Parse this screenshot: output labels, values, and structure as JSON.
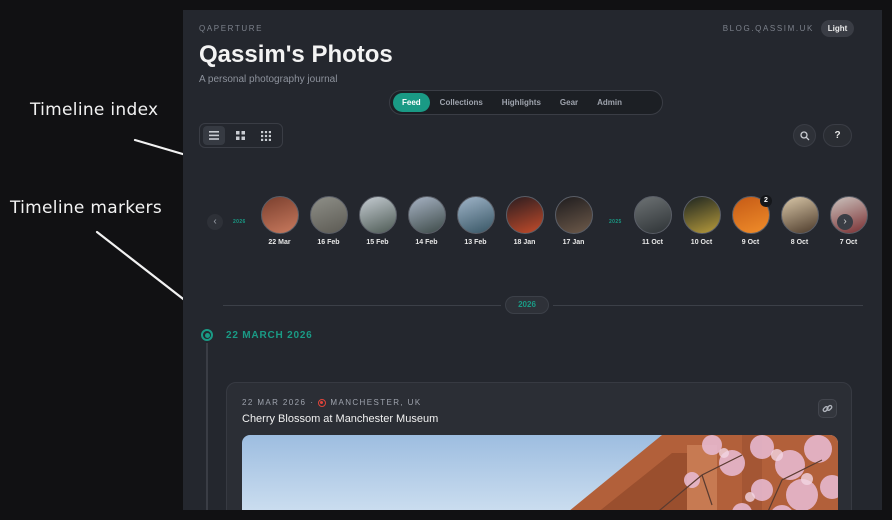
{
  "annotations": {
    "timeline_index": "Timeline index",
    "timeline_markers": "Timeline markers"
  },
  "header": {
    "brand": "QAPERTURE",
    "blog_link": "BLOG.QASSIM.UK",
    "theme_toggle": "Light",
    "title": "Qassim's Photos",
    "subtitle": "A personal photography journal"
  },
  "nav": {
    "tabs": [
      {
        "label": "Feed",
        "active": true
      },
      {
        "label": "Collections",
        "active": false
      },
      {
        "label": "Highlights",
        "active": false
      },
      {
        "label": "Gear",
        "active": false
      },
      {
        "label": "Admin",
        "active": false
      }
    ]
  },
  "toolbar": {
    "view_modes": [
      "list-icon",
      "grid-icon",
      "dense-grid-icon"
    ],
    "active_view": "list",
    "help_label": "?"
  },
  "timeline_index": {
    "year_tags": [
      "2026",
      "2025"
    ],
    "thumbs": [
      {
        "label": "22 Mar",
        "colors": [
          "#7a3f2e",
          "#c97a5e"
        ]
      },
      {
        "label": "16 Feb",
        "colors": [
          "#8e8f88",
          "#5c5a53"
        ]
      },
      {
        "label": "15 Feb",
        "colors": [
          "#c5ccd2",
          "#4d5a54"
        ]
      },
      {
        "label": "14 Feb",
        "colors": [
          "#a7b3c4",
          "#3d4a48"
        ]
      },
      {
        "label": "13 Feb",
        "colors": [
          "#9fb4c8",
          "#375564"
        ]
      },
      {
        "label": "18 Jan",
        "colors": [
          "#2a1c20",
          "#c44c2b"
        ]
      },
      {
        "label": "17 Jan",
        "colors": [
          "#1e1c1e",
          "#6e5a4a"
        ]
      },
      {
        "label": "11 Oct",
        "colors": [
          "#6d7274",
          "#2e3336"
        ]
      },
      {
        "label": "10 Oct",
        "colors": [
          "#1c2420",
          "#b89c3c"
        ]
      },
      {
        "label": "9 Oct",
        "colors": [
          "#c55a16",
          "#f08d2a"
        ],
        "count": "2"
      },
      {
        "label": "8 Oct",
        "colors": [
          "#d9c7a8",
          "#4c3a2a"
        ]
      },
      {
        "label": "7 Oct",
        "colors": [
          "#cbc3be",
          "#7a2f32"
        ]
      }
    ]
  },
  "year_divider": "2026",
  "timeline_marker": {
    "date_heading": "22 MARCH 2026"
  },
  "post": {
    "date": "22 MAR 2026",
    "separator": "·",
    "location": "MANCHESTER, UK",
    "title": "Cherry Blossom at Manchester Museum",
    "colors": {
      "sky": "#b9d2ea",
      "building": "#b2603a",
      "blossom": "#e6b8cf"
    }
  },
  "colors": {
    "accent": "#1a9a85",
    "background": "#24272e",
    "pin": "#e0443a"
  }
}
